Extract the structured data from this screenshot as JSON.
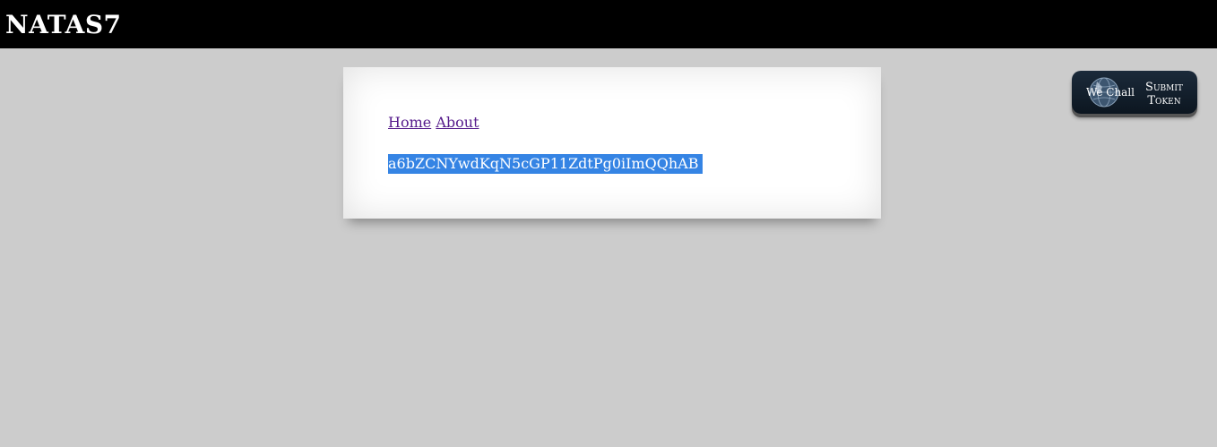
{
  "header": {
    "title": "NATAS7"
  },
  "nav": {
    "links": [
      {
        "label": "Home"
      },
      {
        "label": "About"
      }
    ]
  },
  "content": {
    "secret_text": "a6bZCNYwdKqN5cGP11ZdtPg0iImQQhAB"
  },
  "wechall": {
    "logo_text": "We Chall",
    "submit_line1": "Submit",
    "submit_line2": "Token"
  },
  "colors": {
    "header_bg": "#000000",
    "page_bg": "#cccccc",
    "link": "#551a8b",
    "selection": "#3584e4"
  }
}
